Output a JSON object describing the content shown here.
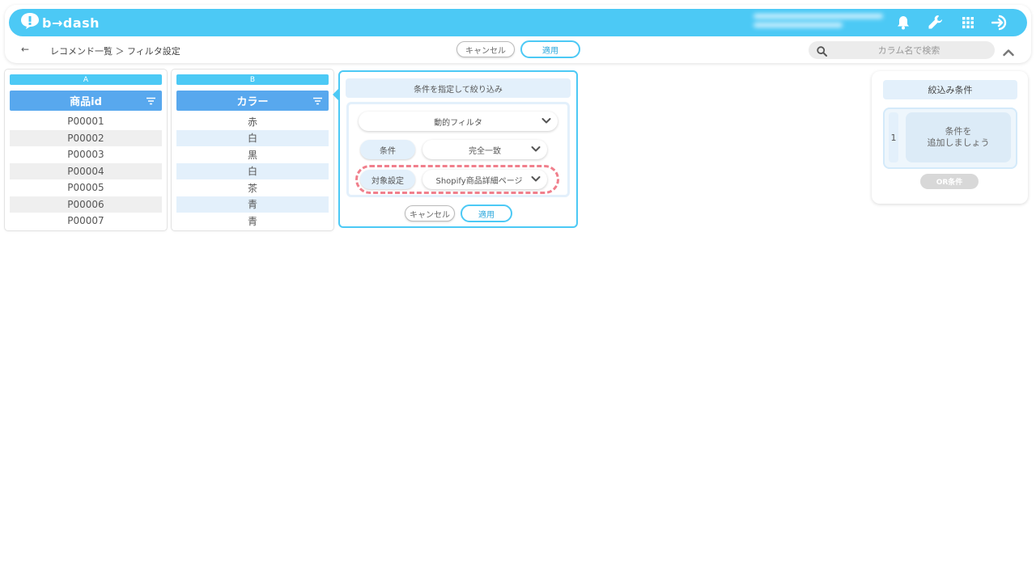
{
  "app": {
    "logo_text": "b→dash"
  },
  "colors": {
    "accent": "#4cc9f5",
    "header_blue": "#58a8ee",
    "highlight": "#f07f8c"
  },
  "icons": [
    "bell-icon",
    "wrench-icon",
    "apps-grid-icon",
    "logout-icon",
    "search-icon",
    "filter-icon",
    "chevron-down-icon",
    "chevron-up-icon",
    "back-arrow-icon"
  ],
  "subbar": {
    "back": "←",
    "breadcrumb": "レコメンド一覧 ＞ フィルタ設定",
    "cancel_label": "キャンセル",
    "apply_label": "適用",
    "search_placeholder": "カラム名で検索"
  },
  "columns": [
    {
      "letter": "A",
      "header": "商品id",
      "rows": [
        "P00001",
        "P00002",
        "P00003",
        "P00004",
        "P00005",
        "P00006",
        "P00007"
      ]
    },
    {
      "letter": "B",
      "header": "カラー",
      "rows": [
        "赤",
        "白",
        "黒",
        "白",
        "茶",
        "青",
        "青"
      ]
    }
  ],
  "filter_panel": {
    "title": "条件を指定して絞り込み",
    "filter_type": "動的フィルタ",
    "condition_label": "条件",
    "condition_value": "完全一致",
    "target_label": "対象設定",
    "target_value": "Shopify商品詳細ページ",
    "cancel_label": "キャンセル",
    "apply_label": "適用"
  },
  "conditions_panel": {
    "title": "絞込み条件",
    "index": "1",
    "add_text": "条件を\n追加しましょう",
    "or_label": "OR条件"
  }
}
